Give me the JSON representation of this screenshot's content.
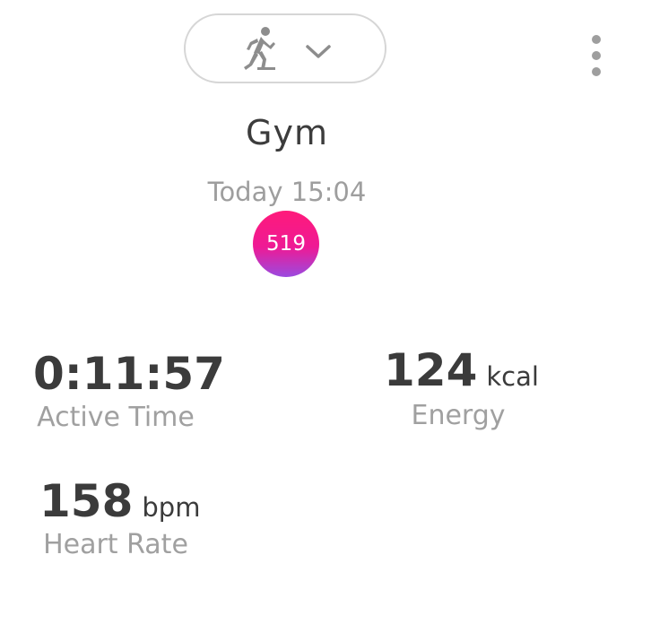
{
  "header": {
    "activity_icon": "running-icon",
    "dropdown_icon": "chevron-down-icon",
    "menu_icon": "more-vertical-icon"
  },
  "workout": {
    "title": "Gym",
    "timestamp": "Today 15:04",
    "score": "519"
  },
  "metrics": {
    "active_time": {
      "value": "0:11:57",
      "label": "Active Time"
    },
    "energy": {
      "value": "124",
      "unit": "kcal",
      "label": "Energy"
    },
    "heart_rate": {
      "value": "158",
      "unit": "bpm",
      "label": "Heart Rate"
    }
  },
  "colors": {
    "badge_top": "#ff1a7a",
    "badge_bottom": "#9a4ae0",
    "label_gray": "#a0a0a0",
    "text_dark": "#3b3b3b"
  }
}
